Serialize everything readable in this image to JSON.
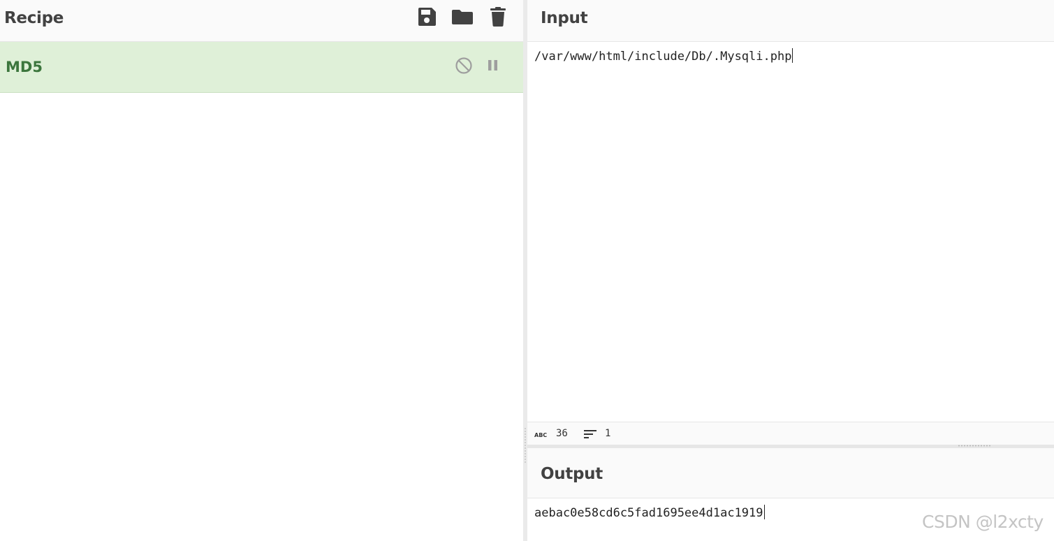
{
  "recipe": {
    "title": "Recipe",
    "toolbar": {
      "save_icon": "save-icon",
      "load_icon": "folder-icon",
      "clear_icon": "trash-icon"
    },
    "operations": [
      {
        "name": "MD5",
        "disable_icon": "disable-icon",
        "breakpoint_icon": "pause-icon"
      }
    ]
  },
  "input": {
    "title": "Input",
    "value": "/var/www/html/include/Db/.Mysqli.php",
    "stats": {
      "length_icon": "abc-icon",
      "length": "36",
      "lines_icon": "lines-icon",
      "lines": "1"
    }
  },
  "output": {
    "title": "Output",
    "value": "aebac0e58cd6c5fad1695ee4d1ac1919"
  },
  "watermark": "CSDN @l2xcty",
  "colors": {
    "operation_bg": "#dff0d8",
    "operation_text": "#3c763d",
    "icon": "#424242"
  }
}
